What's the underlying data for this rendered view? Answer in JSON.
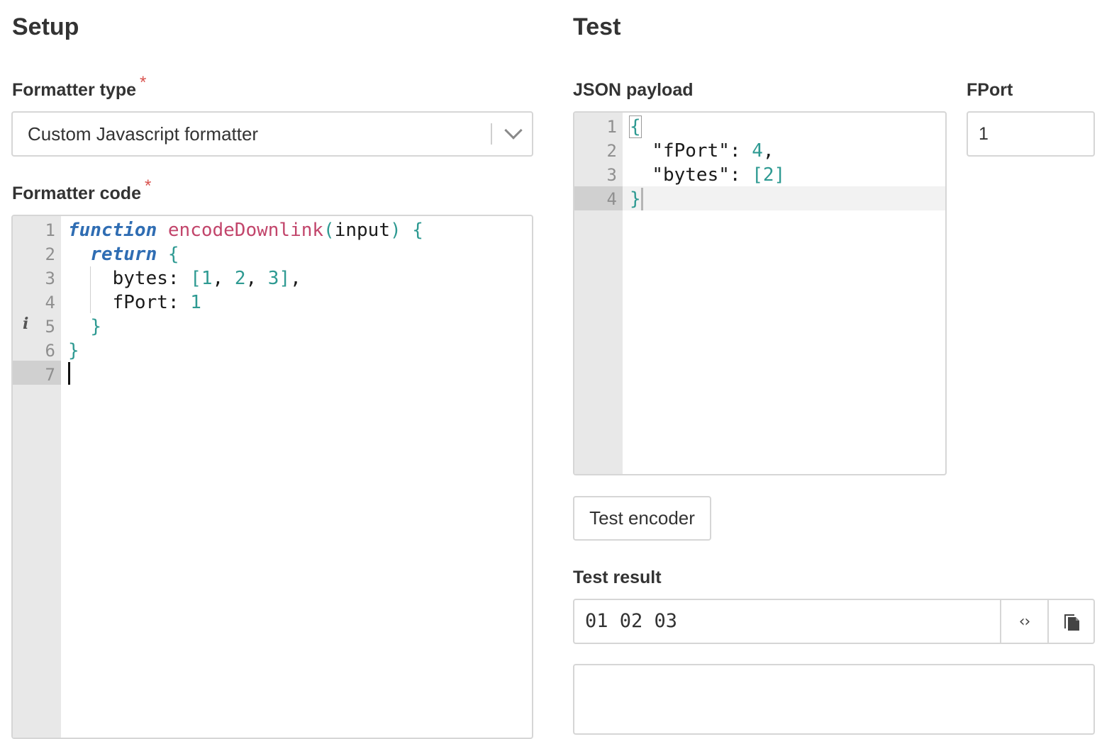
{
  "setup": {
    "heading": "Setup",
    "formatter_type": {
      "label": "Formatter type",
      "required_marker": "*",
      "selected": "Custom Javascript formatter"
    },
    "formatter_code": {
      "label": "Formatter code",
      "required_marker": "*",
      "line_numbers": [
        "1",
        "2",
        "3",
        "4",
        "5",
        "6",
        "7"
      ],
      "lines": [
        "function encodeDownlink(input) {",
        "  return {",
        "    bytes: [1, 2, 3],",
        "    fPort: 1",
        "  }",
        "}",
        ""
      ],
      "gutter_marker_line5": "i"
    }
  },
  "test": {
    "heading": "Test",
    "json_payload": {
      "label": "JSON payload",
      "line_numbers": [
        "1",
        "2",
        "3",
        "4"
      ],
      "lines": [
        "{",
        "  \"fPort\": 4,",
        "  \"bytes\": [2]",
        "}"
      ]
    },
    "fport": {
      "label": "FPort",
      "value": "1"
    },
    "test_button_label": "Test encoder",
    "test_result": {
      "label": "Test result",
      "value": "01 02 03",
      "toggle_icon": "code-brackets-icon",
      "copy_icon": "copy-icon"
    }
  },
  "colors": {
    "keyword": "#2f6db3",
    "function_name": "#c2456b",
    "number": "#2e9a92",
    "required": "#d9534f"
  }
}
